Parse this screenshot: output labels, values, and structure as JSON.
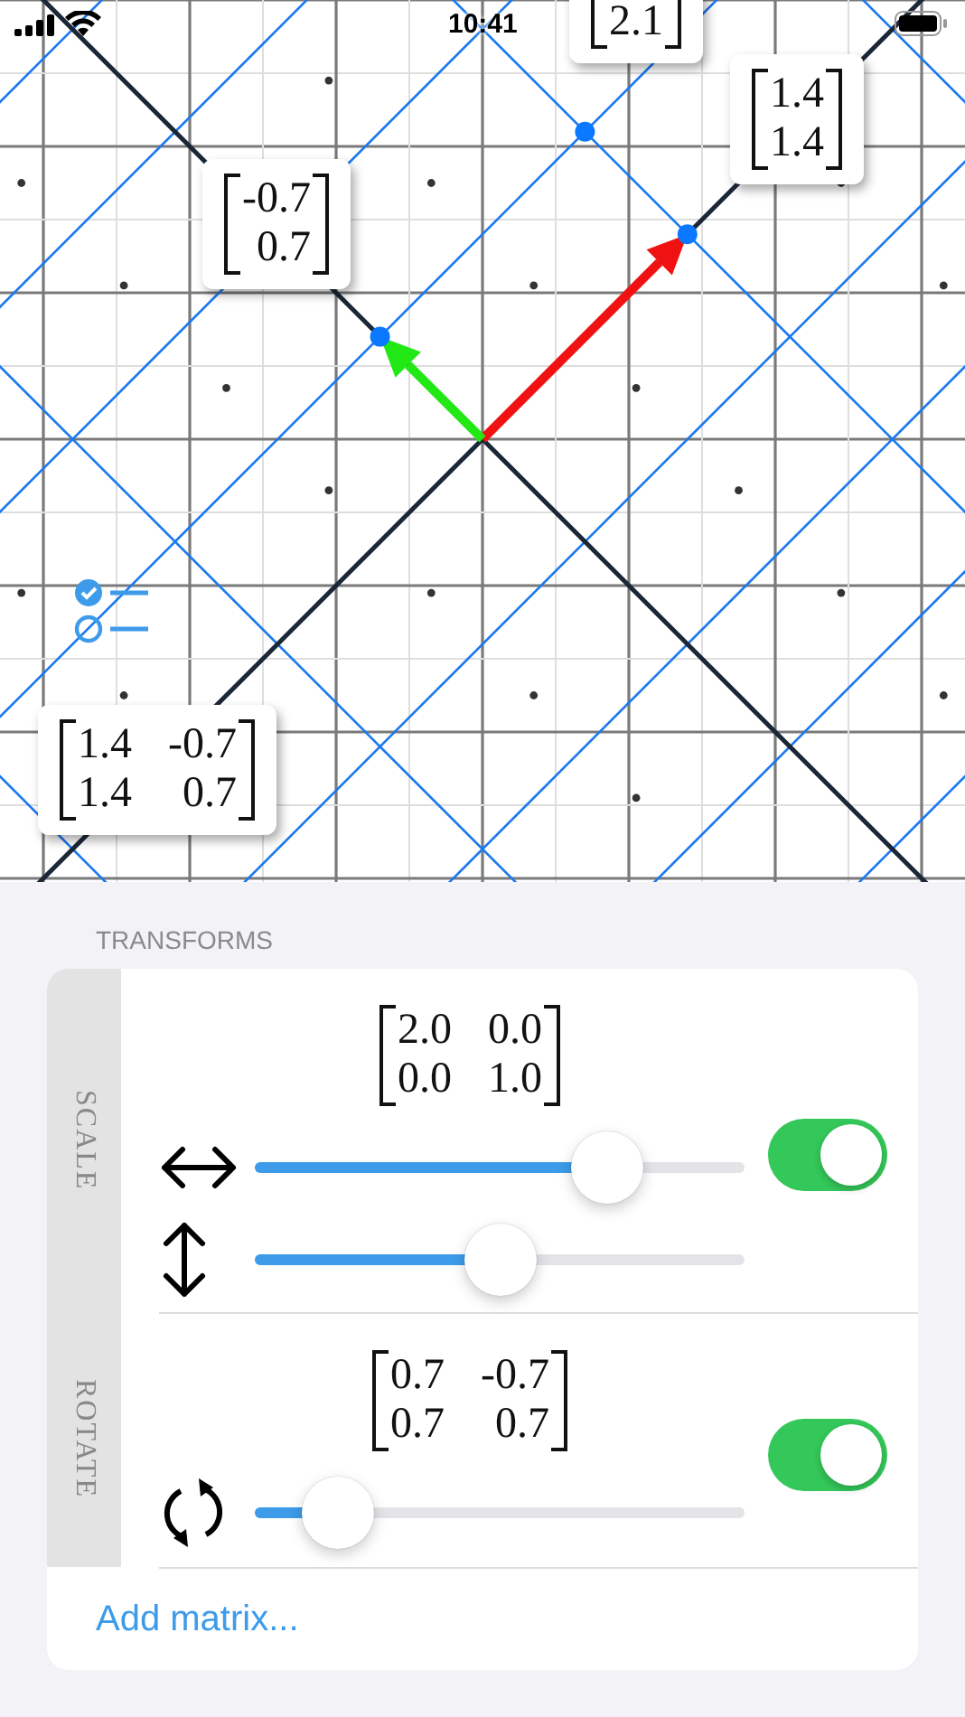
{
  "status_bar": {
    "time": "10:41"
  },
  "canvas": {
    "labels": [
      {
        "cells": [
          [
            "2.1"
          ]
        ]
      },
      {
        "cells": [
          [
            "1.4"
          ],
          [
            "1.4"
          ]
        ]
      },
      {
        "cells": [
          [
            "-0.7"
          ],
          [
            "0.7"
          ]
        ]
      },
      {
        "cells": [
          [
            "1.4",
            "-0.7"
          ],
          [
            "1.4",
            "0.7"
          ]
        ]
      }
    ]
  },
  "transforms": {
    "header": "TRANSFORMS",
    "sections": [
      {
        "name": "SCALE",
        "matrix": [
          [
            "2.0",
            "0.0"
          ],
          [
            "0.0",
            "1.0"
          ]
        ],
        "enabled": true,
        "sliders": [
          {
            "kind": "horizontal",
            "level": 0.72
          },
          {
            "kind": "vertical",
            "level": 0.5
          }
        ]
      },
      {
        "name": "ROTATE",
        "matrix": [
          [
            "0.7",
            "-0.7"
          ],
          [
            "0.7",
            "0.7"
          ]
        ],
        "enabled": true,
        "sliders": [
          {
            "kind": "rotate",
            "level": 0.17
          }
        ]
      }
    ],
    "add_button": "Add matrix..."
  }
}
